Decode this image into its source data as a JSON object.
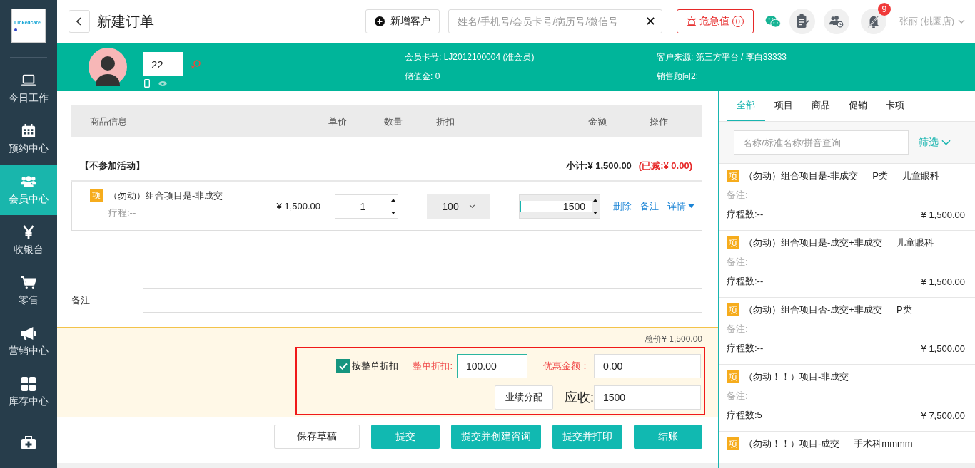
{
  "sidebar": {
    "logo": "Linkedcare",
    "items": [
      {
        "kind": "laptop",
        "label": "今日工作",
        "selected": false
      },
      {
        "kind": "calendar",
        "label": "预约中心",
        "selected": false
      },
      {
        "kind": "users",
        "label": "会员中心",
        "selected": true
      },
      {
        "kind": "yen",
        "label": "收银台",
        "selected": false
      },
      {
        "kind": "cart",
        "label": "零售",
        "selected": false
      },
      {
        "kind": "megaphone",
        "label": "营销中心",
        "selected": false
      },
      {
        "kind": "grid",
        "label": "库存中心",
        "selected": false
      },
      {
        "kind": "medkit",
        "selected": false
      }
    ]
  },
  "header": {
    "title": "新建订单",
    "add_customer": "新增客户",
    "search": {
      "placeholder": "姓名/手机号/会员卡号/病历号/微信号"
    },
    "alert": {
      "label": "危急值",
      "count": "0"
    },
    "notification_count": "9",
    "user": "张丽 (桃園店)"
  },
  "customer": {
    "name": "22",
    "member_card_label": "会员卡号:",
    "member_card": "LJ2012100004 (准会员)",
    "stored_value_label": "储值金:",
    "stored_value": "0",
    "source_label": "客户来源:",
    "source": "第三方平台 / 李白33333",
    "advisor_label": "销售顾问2:"
  },
  "order_table": {
    "columns": [
      "商品信息",
      "单价",
      "数量",
      "折扣",
      "金额",
      "操作"
    ],
    "group": {
      "title": "【不参加活动】",
      "subtotal": "小计:¥ 1,500.00",
      "reduced": "(已减:¥ 0.00)"
    },
    "rows": [
      {
        "badge": "项",
        "name": "（勿动）组合项目是-非成交",
        "course": "疗程:--",
        "price": "¥ 1,500.00",
        "quantity": "1",
        "discount": "100",
        "amount": "1500",
        "actions": [
          "删除",
          "备注"
        ],
        "detail": "详情"
      }
    ]
  },
  "remark": {
    "label": "备注"
  },
  "summary": {
    "total": "总价¥ 1,500.00",
    "whole_discount": {
      "label": "按整单折扣",
      "checked": true
    },
    "discount_label": "整单折扣:",
    "discount_value": "100.00",
    "reduction_label": "优惠金额：",
    "reduction_value": "0.00",
    "allocate_button": "业绩分配",
    "receivable_label": "应收:",
    "receivable_value": "1500"
  },
  "actions": [
    {
      "label": "保存草稿",
      "kind": "secondary"
    },
    {
      "label": "提交",
      "kind": "primary"
    },
    {
      "label": "提交并创建咨询",
      "kind": "primary"
    },
    {
      "label": "提交并打印",
      "kind": "primary"
    },
    {
      "label": "结账",
      "kind": "primary"
    }
  ],
  "catalog": {
    "tabs": [
      {
        "label": "全部",
        "selected": true
      },
      {
        "label": "项目",
        "selected": false
      },
      {
        "label": "商品",
        "selected": false
      },
      {
        "label": "促销",
        "selected": false
      },
      {
        "label": "卡项",
        "selected": false
      }
    ],
    "search": {
      "placeholder": "名称/标准名称/拼音查询"
    },
    "filter": "筛选",
    "items": [
      {
        "badge": "项",
        "name": "（勿动）组合项目是-非成交",
        "tags": [
          "P类",
          "儿童眼科"
        ],
        "remark_label": "备注:",
        "course": "疗程数:--",
        "price": "¥ 1,500.00"
      },
      {
        "badge": "项",
        "name": "（勿动）组合项目是-成交+非成交",
        "tags": [
          "儿童眼科"
        ],
        "remark_label": "备注:",
        "course": "疗程数:--",
        "price": "¥ 1,500.00"
      },
      {
        "badge": "项",
        "name": "（勿动）组合项目否-成交+非成交",
        "tags": [
          "P类"
        ],
        "remark_label": "备注:",
        "course": "疗程数:--",
        "price": "¥ 1,500.00"
      },
      {
        "badge": "项",
        "name": "（勿动！！）项目-非成交",
        "remark_label": "备注:",
        "course": "疗程数:5",
        "price": "¥ 7,500.00"
      },
      {
        "badge": "项",
        "name": "（勿动！！）项目-成交",
        "tags": [
          "手术科mmmm"
        ]
      }
    ]
  }
}
